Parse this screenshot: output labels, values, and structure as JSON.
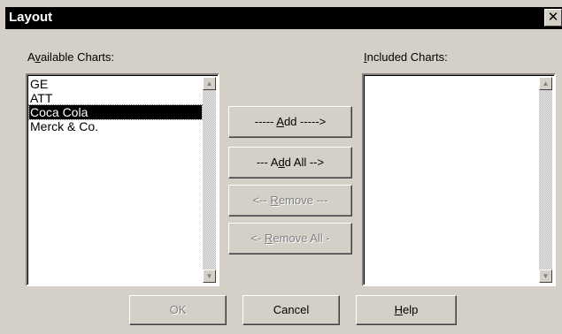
{
  "window": {
    "title": "Layout",
    "close_glyph": "✕"
  },
  "available": {
    "label": "Available Charts:",
    "label_parts": [
      "A",
      "v",
      "ailable Charts:"
    ],
    "items": [
      "GE",
      "ATT",
      "Coca Cola",
      "Merck & Co."
    ],
    "selected_index": 2
  },
  "included": {
    "label": "Included Charts:",
    "label_parts": [
      "",
      "I",
      "ncluded Charts:"
    ],
    "items": []
  },
  "actions": {
    "add": {
      "label": "----- Add ----->",
      "parts": [
        "----- ",
        "A",
        "dd ----->"
      ],
      "enabled": true
    },
    "add_all": {
      "label": "--- Add All -->",
      "parts": [
        "--- A",
        "d",
        "d All -->"
      ],
      "enabled": true
    },
    "remove": {
      "label": "<-- Remove ---",
      "parts": [
        "<-- ",
        "R",
        "emove ---"
      ],
      "enabled": false
    },
    "remove_all": {
      "label": "<- Remove All -",
      "parts": [
        "<- ",
        "R",
        "emove All -"
      ],
      "enabled": false
    }
  },
  "footer": {
    "ok": {
      "label": "OK",
      "enabled": false
    },
    "cancel": {
      "label": "Cancel",
      "enabled": true
    },
    "help": {
      "label": "Help",
      "parts": [
        "",
        "H",
        "elp"
      ],
      "enabled": true
    }
  },
  "colors": {
    "face": "#d4d0c8",
    "selection": "#000000",
    "disabled_text": "#808080"
  }
}
